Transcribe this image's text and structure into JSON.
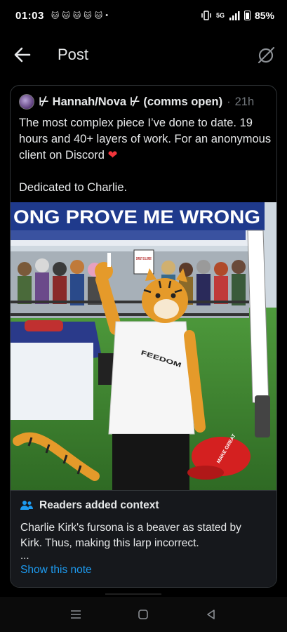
{
  "status_bar": {
    "time": "01:03",
    "notification_icons": [
      "cat-icon",
      "cat-icon",
      "cat-icon",
      "cat-icon",
      "cat-icon"
    ],
    "network": "5G",
    "battery": "85%"
  },
  "header": {
    "title": "Post"
  },
  "post": {
    "author": "⊬ Hannah/Nova ⊬ (comms open)",
    "separator": "·",
    "time": "21h",
    "text": "The most complex piece I’ve done to date. 19 hours and 40+ layers of work. For an anonymous client on Discord",
    "dedication": "Dedicated to Charlie.",
    "image": {
      "banner_text": "ONG PROVE ME WRONG",
      "sign_text": "DIRGT IS LORD!",
      "shirt_text": "FEEDOM",
      "hat_text": "MAKE GREAT"
    }
  },
  "context_note": {
    "heading": "Readers added context",
    "body": "Charlie Kirk's fursona is a beaver as stated by Kirk. Thus, making this larp incorrect.",
    "more": "...",
    "link": "Show this note"
  },
  "colors": {
    "background": "#000000",
    "accent": "#1d9bf0",
    "muted": "#71767b",
    "heart": "#f2353b",
    "note_bg": "#16181c"
  }
}
